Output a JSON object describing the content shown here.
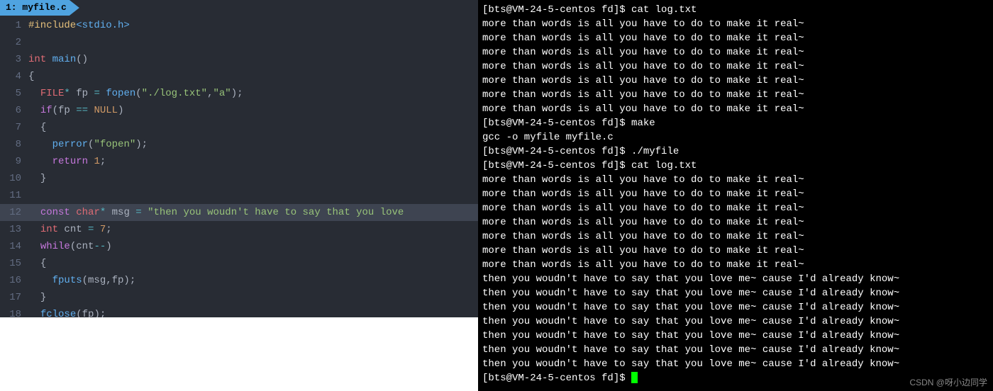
{
  "editor": {
    "tab": "1: myfile.c",
    "highlightLine": 12,
    "lines": [
      {
        "n": 1,
        "tokens": [
          [
            "preproc",
            "#include"
          ],
          [
            "include",
            "<stdio.h>"
          ]
        ]
      },
      {
        "n": 2,
        "tokens": []
      },
      {
        "n": 3,
        "tokens": [
          [
            "type",
            "int"
          ],
          [
            "var",
            " "
          ],
          [
            "fn",
            "main"
          ],
          [
            "punc",
            "()"
          ]
        ]
      },
      {
        "n": 4,
        "tokens": [
          [
            "punc",
            "{"
          ]
        ]
      },
      {
        "n": 5,
        "tokens": [
          [
            "var",
            "  "
          ],
          [
            "type",
            "FILE"
          ],
          [
            "op",
            "*"
          ],
          [
            "var",
            " fp "
          ],
          [
            "op",
            "="
          ],
          [
            "var",
            " "
          ],
          [
            "fn",
            "fopen"
          ],
          [
            "punc",
            "("
          ],
          [
            "str",
            "\"./log.txt\""
          ],
          [
            "punc",
            ","
          ],
          [
            "str",
            "\"a\""
          ],
          [
            "punc",
            ");"
          ]
        ]
      },
      {
        "n": 6,
        "tokens": [
          [
            "var",
            "  "
          ],
          [
            "kw",
            "if"
          ],
          [
            "punc",
            "(fp "
          ],
          [
            "op",
            "=="
          ],
          [
            "punc",
            " "
          ],
          [
            "const",
            "NULL"
          ],
          [
            "punc",
            ")"
          ]
        ]
      },
      {
        "n": 7,
        "tokens": [
          [
            "var",
            "  "
          ],
          [
            "punc",
            "{"
          ]
        ]
      },
      {
        "n": 8,
        "tokens": [
          [
            "var",
            "    "
          ],
          [
            "fn",
            "perror"
          ],
          [
            "punc",
            "("
          ],
          [
            "str",
            "\"fopen\""
          ],
          [
            "punc",
            ");"
          ]
        ]
      },
      {
        "n": 9,
        "tokens": [
          [
            "var",
            "    "
          ],
          [
            "kw",
            "return"
          ],
          [
            "var",
            " "
          ],
          [
            "num",
            "1"
          ],
          [
            "punc",
            ";"
          ]
        ]
      },
      {
        "n": 10,
        "tokens": [
          [
            "var",
            "  "
          ],
          [
            "punc",
            "}"
          ]
        ]
      },
      {
        "n": 11,
        "tokens": []
      },
      {
        "n": 12,
        "tokens": [
          [
            "var",
            "  "
          ],
          [
            "kw",
            "const"
          ],
          [
            "var",
            " "
          ],
          [
            "type",
            "char"
          ],
          [
            "op",
            "*"
          ],
          [
            "var",
            " msg "
          ],
          [
            "op",
            "="
          ],
          [
            "var",
            " "
          ],
          [
            "str",
            "\"then you woudn't have to say that you love"
          ]
        ]
      },
      {
        "n": 13,
        "tokens": [
          [
            "var",
            "  "
          ],
          [
            "type",
            "int"
          ],
          [
            "var",
            " cnt "
          ],
          [
            "op",
            "="
          ],
          [
            "var",
            " "
          ],
          [
            "num",
            "7"
          ],
          [
            "punc",
            ";"
          ]
        ]
      },
      {
        "n": 14,
        "tokens": [
          [
            "var",
            "  "
          ],
          [
            "kw",
            "while"
          ],
          [
            "punc",
            "(cnt"
          ],
          [
            "op",
            "--"
          ],
          [
            "punc",
            ")"
          ]
        ]
      },
      {
        "n": 15,
        "tokens": [
          [
            "var",
            "  "
          ],
          [
            "punc",
            "{"
          ]
        ]
      },
      {
        "n": 16,
        "tokens": [
          [
            "var",
            "    "
          ],
          [
            "fn",
            "fputs"
          ],
          [
            "punc",
            "(msg,fp);"
          ]
        ]
      },
      {
        "n": 17,
        "tokens": [
          [
            "var",
            "  "
          ],
          [
            "punc",
            "}"
          ]
        ]
      },
      {
        "n": 18,
        "tokens": [
          [
            "var",
            "  "
          ],
          [
            "fn",
            "fclose"
          ],
          [
            "punc",
            "(fp);"
          ]
        ]
      }
    ]
  },
  "terminal": {
    "prompt": "[bts@VM-24-5-centos fd]$ ",
    "more_line": "more than words is all you have to do to make it real~",
    "then_line": "then you woudn't have to say that you love me~ cause I'd already know~",
    "cmd_cat": "cat log.txt",
    "cmd_make": "make",
    "make_output": "gcc -o myfile myfile.c",
    "cmd_run": "./myfile",
    "watermark": "CSDN @呀小边同学"
  }
}
